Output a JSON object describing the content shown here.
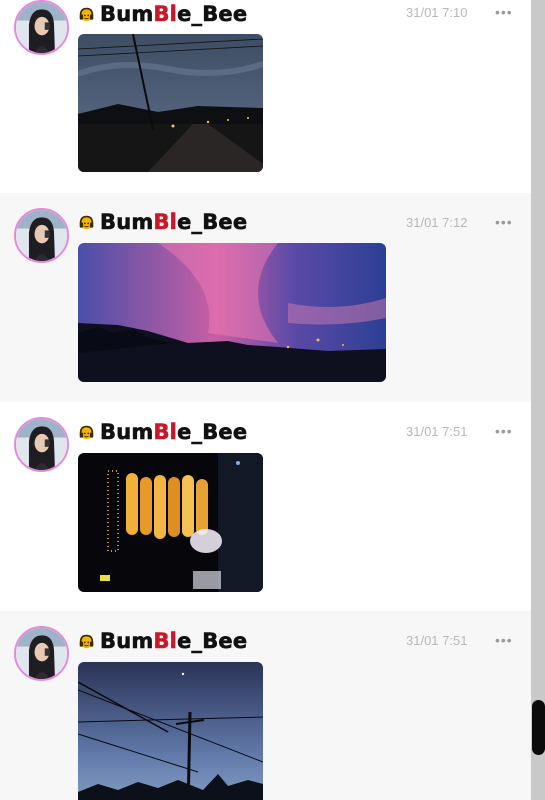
{
  "posts": [
    {
      "username_parts": [
        "Bum",
        "Bl",
        "e_Bee"
      ],
      "timestamp": "31/01 7:10",
      "more_label": "•••",
      "photo_icon": "dusk-street-photo"
    },
    {
      "username_parts": [
        "Bum",
        "Bl",
        "e_Bee"
      ],
      "timestamp": "31/01 7:12",
      "more_label": "•••",
      "photo_icon": "pink-sunset-photo"
    },
    {
      "username_parts": [
        "Bum",
        "Bl",
        "e_Bee"
      ],
      "timestamp": "31/01 7:51",
      "more_label": "•••",
      "photo_icon": "night-lights-photo"
    },
    {
      "username_parts": [
        "Bum",
        "Bl",
        "e_Bee"
      ],
      "timestamp": "31/01 7:51",
      "more_label": "•••",
      "photo_icon": "power-lines-sky-photo"
    }
  ],
  "colors": {
    "username": "#111111",
    "username_highlight": "#c8182a",
    "avatar_ring": "#e58ad9",
    "timestamp": "#b8b8b8",
    "alt_row_bg": "#f7f7f7"
  }
}
